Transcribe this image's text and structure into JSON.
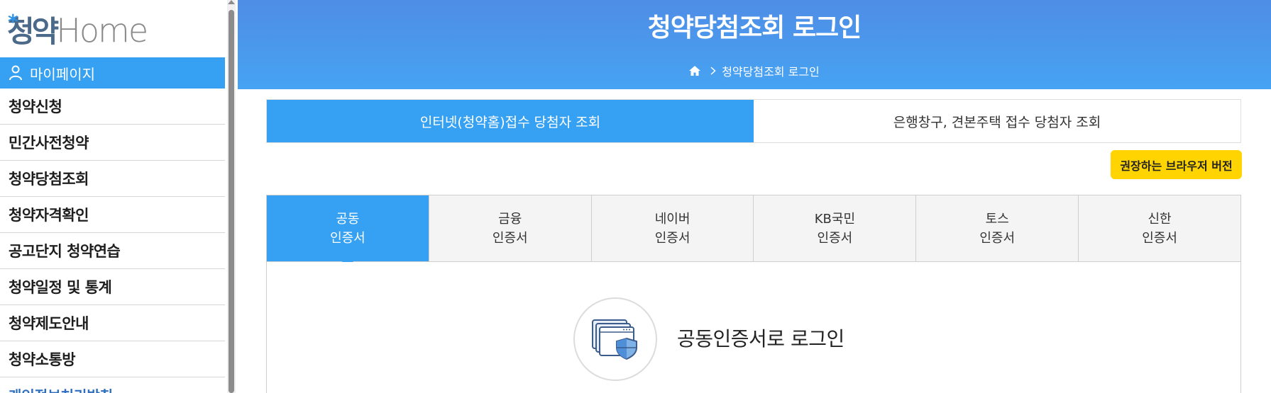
{
  "sidebar": {
    "logo_ko": "청약",
    "logo_en": "Home",
    "mypage_label": "마이페이지",
    "items": [
      {
        "label": "청약신청"
      },
      {
        "label": "민간사전청약"
      },
      {
        "label": "청약당첨조회"
      },
      {
        "label": "청약자격확인"
      },
      {
        "label": "공고단지 청약연습"
      },
      {
        "label": "청약일정 및 통계"
      },
      {
        "label": "청약제도안내"
      },
      {
        "label": "청약소통방"
      }
    ],
    "more_label": "개인정보처리방침"
  },
  "header": {
    "title": "청약당첨조회 로그인",
    "breadcrumb_current": "청약당첨조회 로그인"
  },
  "top_tabs": [
    {
      "label": "인터넷(청약홈)접수 당첨자 조회",
      "active": true
    },
    {
      "label": "은행창구, 견본주택 접수 당첨자 조회",
      "active": false
    }
  ],
  "browser_button": {
    "label": "권장하는 브라우저 버전"
  },
  "cert_tabs": [
    {
      "line1": "공동",
      "line2": "인증서",
      "active": true
    },
    {
      "line1": "금융",
      "line2": "인증서",
      "active": false
    },
    {
      "line1": "네이버",
      "line2": "인증서",
      "active": false
    },
    {
      "line1": "KB국민",
      "line2": "인증서",
      "active": false
    },
    {
      "line1": "토스",
      "line2": "인증서",
      "active": false
    },
    {
      "line1": "신한",
      "line2": "인증서",
      "active": false
    }
  ],
  "login": {
    "label": "공동인증서로 로그인"
  },
  "colors": {
    "primary": "#36a1f2",
    "banner_top": "#4f8de6",
    "button_yellow": "#ffd400"
  },
  "icons": [
    "person-icon",
    "home-icon",
    "chevron-right-icon",
    "certificate-shield-icon"
  ]
}
